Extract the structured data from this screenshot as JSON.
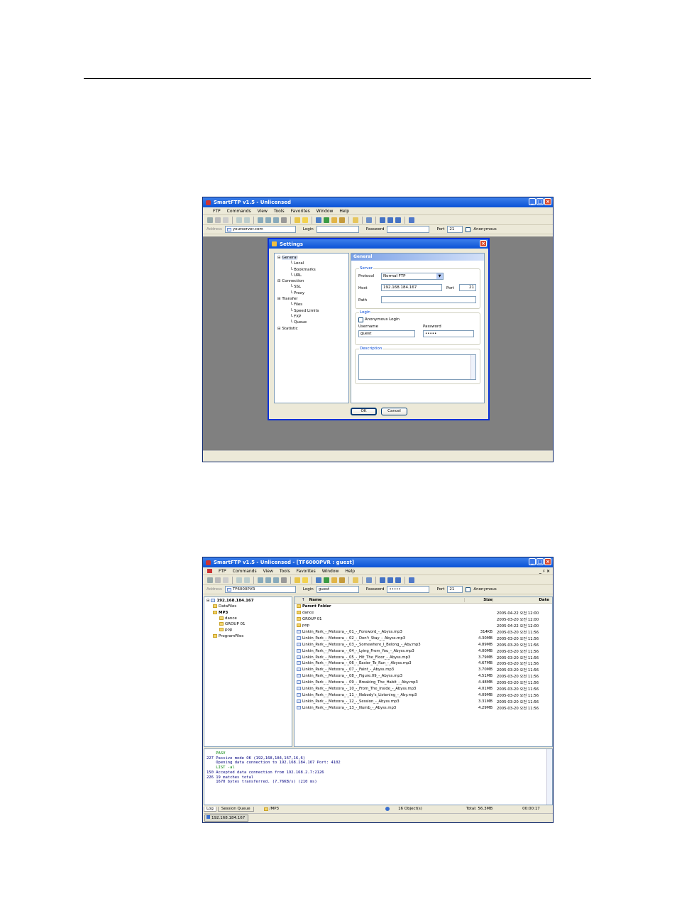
{
  "window1": {
    "title": "SmartFTP v1.5 - Unlicensed",
    "menu": [
      "FTP",
      "Commands",
      "View",
      "Tools",
      "Favorites",
      "Window",
      "Help"
    ],
    "address_label": "Address",
    "address_value": "yourserver.com",
    "login_label": "Login",
    "login_value": "",
    "password_label": "Password",
    "password_value": "",
    "port_label": "Port",
    "port_value": "21",
    "anonymous_label": "Anonymous"
  },
  "settings": {
    "title": "Settings",
    "tree": [
      {
        "label": "General",
        "level": 0
      },
      {
        "label": "Local",
        "level": 1
      },
      {
        "label": "Bookmarks",
        "level": 1
      },
      {
        "label": "URL",
        "level": 1
      },
      {
        "label": "Connection",
        "level": 0
      },
      {
        "label": "SSL",
        "level": 1
      },
      {
        "label": "Proxy",
        "level": 1
      },
      {
        "label": "Transfer",
        "level": 0
      },
      {
        "label": "Files",
        "level": 1
      },
      {
        "label": "Speed Limits",
        "level": 1
      },
      {
        "label": "FXP",
        "level": 1
      },
      {
        "label": "Queue",
        "level": 1
      },
      {
        "label": "Statistic",
        "level": 0
      }
    ],
    "panel_title": "General",
    "server_group": "Server",
    "protocol_label": "Protocol",
    "protocol_value": "Normal FTP",
    "host_label": "Host",
    "host_value": "192.168.184.167",
    "port_label": "Port",
    "port_value": "21",
    "path_label": "Path",
    "path_value": "",
    "login_group": "Login",
    "anonymous_login": "Anonymous Login",
    "username_label": "Username",
    "username_value": "guest",
    "password_label": "Password",
    "password_value": "•••••",
    "description_group": "Description",
    "ok": "OK",
    "cancel": "Cancel"
  },
  "window2": {
    "title": "SmartFTP v1.5 - Unlicensed - [TF6000PVR : guest]",
    "menu": [
      "FTP",
      "Commands",
      "View",
      "Tools",
      "Favorites",
      "Window",
      "Help"
    ],
    "mdi_controls": "_ ♯ ×",
    "address_label": "Address",
    "address_value": "TF6000PVR",
    "login_label": "Login",
    "login_value": "guest",
    "password_label": "Password",
    "password_value": "•••••",
    "port_label": "Port",
    "port_value": "21",
    "anonymous_label": "Anonymous",
    "tree": [
      {
        "label": "192.168.184.167",
        "level": 0,
        "bold": true
      },
      {
        "label": "DataFiles",
        "level": 1
      },
      {
        "label": "MP3",
        "level": 1,
        "bold": true
      },
      {
        "label": "dance",
        "level": 2
      },
      {
        "label": "GROUP 01",
        "level": 2
      },
      {
        "label": "pop",
        "level": 2
      },
      {
        "label": "ProgramFiles",
        "level": 1
      }
    ],
    "columns": {
      "name": "Name",
      "size": "Size",
      "date": "Date"
    },
    "files": [
      {
        "name": "Parent Folder",
        "size": "",
        "date": "",
        "type": "folder",
        "bold": true
      },
      {
        "name": "dance",
        "size": "",
        "date": "2005-04-22 오전 12:00",
        "type": "folder"
      },
      {
        "name": "GROUP 01",
        "size": "",
        "date": "2005-03-20 오전 12:00",
        "type": "folder"
      },
      {
        "name": "pop",
        "size": "",
        "date": "2005-04-22 오전 12:00",
        "type": "folder"
      },
      {
        "name": "Linkin_Park_-_Meteora_-_01_-_Foreword_-_Abyss.mp3",
        "size": "314KB",
        "date": "2005-03-20 오전 11:56",
        "type": "mp3"
      },
      {
        "name": "Linkin_Park_-_Meteora_-_02_-_Don't_Stay_-_Abyss.mp3",
        "size": "4.30MB",
        "date": "2005-03-20 오전 11:56",
        "type": "mp3"
      },
      {
        "name": "Linkin_Park_-_Meteora_-_03_-_Somewhere_I_Belong_-_Aby.mp3",
        "size": "4.89MB",
        "date": "2005-03-20 오전 11:56",
        "type": "mp3"
      },
      {
        "name": "Linkin_Park_-_Meteora_-_04_-_Lying_From_You_-_Abyss.mp3",
        "size": "4.00MB",
        "date": "2005-03-20 오전 11:56",
        "type": "mp3"
      },
      {
        "name": "Linkin_Park_-_Meteora_-_05_-_Hit_The_Floor_-_Abyss.mp3",
        "size": "3.79MB",
        "date": "2005-03-20 오전 11:56",
        "type": "mp3"
      },
      {
        "name": "Linkin_Park_-_Meteora_-_06_-_Easier_To_Run_-_Abyss.mp3",
        "size": "4.67MB",
        "date": "2005-03-20 오전 11:56",
        "type": "mp3"
      },
      {
        "name": "Linkin_Park_-_Meteora_-_07_-_Faint_-_Abyss.mp3",
        "size": "3.70MB",
        "date": "2005-03-20 오전 11:56",
        "type": "mp3"
      },
      {
        "name": "Linkin_Park_-_Meteora_-_08_-_Figure.09_-_Abyss.mp3",
        "size": "4.51MB",
        "date": "2005-03-20 오전 11:56",
        "type": "mp3"
      },
      {
        "name": "Linkin_Park_-_Meteora_-_09_-_Breaking_The_Habit_-_Aby.mp3",
        "size": "4.48MB",
        "date": "2005-03-20 오전 11:56",
        "type": "mp3"
      },
      {
        "name": "Linkin_Park_-_Meteora_-_10_-_From_The_Inside_-_Abyss.mp3",
        "size": "4.01MB",
        "date": "2005-03-20 오전 11:56",
        "type": "mp3"
      },
      {
        "name": "Linkin_Park_-_Meteora_-_11_-_Nobody's_Listening_-_Aby.mp3",
        "size": "4.09MB",
        "date": "2005-03-20 오전 11:56",
        "type": "mp3"
      },
      {
        "name": "Linkin_Park_-_Meteora_-_12_-_Session_-_Abyss.mp3",
        "size": "3.31MB",
        "date": "2005-03-20 오전 11:56",
        "type": "mp3"
      },
      {
        "name": "Linkin_Park_-_Meteora_-_13_-_Numb_-_Abyss.mp3",
        "size": "4.29MB",
        "date": "2005-03-20 오전 11:56",
        "type": "mp3"
      }
    ],
    "log": [
      {
        "text": "    PASV",
        "color": "g"
      },
      {
        "text": "227 Passive mode OK (192,168,184,167,16,6)",
        "color": "b"
      },
      {
        "text": "    Opening data connection to 192.168.184.167 Port: 4102",
        "color": "b"
      },
      {
        "text": "    LIST -al",
        "color": "g"
      },
      {
        "text": "150 Accepted data connection from 192.168.2.7:2126",
        "color": "b"
      },
      {
        "text": "226 19 matches total",
        "color": "b"
      },
      {
        "text": "    1670 bytes transferred. (7.76KB/s) (210 ms)",
        "color": "b"
      }
    ],
    "tabs": [
      "Log",
      "Session Queue"
    ],
    "status_path": "/MP3",
    "status_objects": "16 Object(s)",
    "status_total": "Total: 56.3MB",
    "status_time": "00:00:17",
    "taskbar": "192.168.184.167"
  }
}
